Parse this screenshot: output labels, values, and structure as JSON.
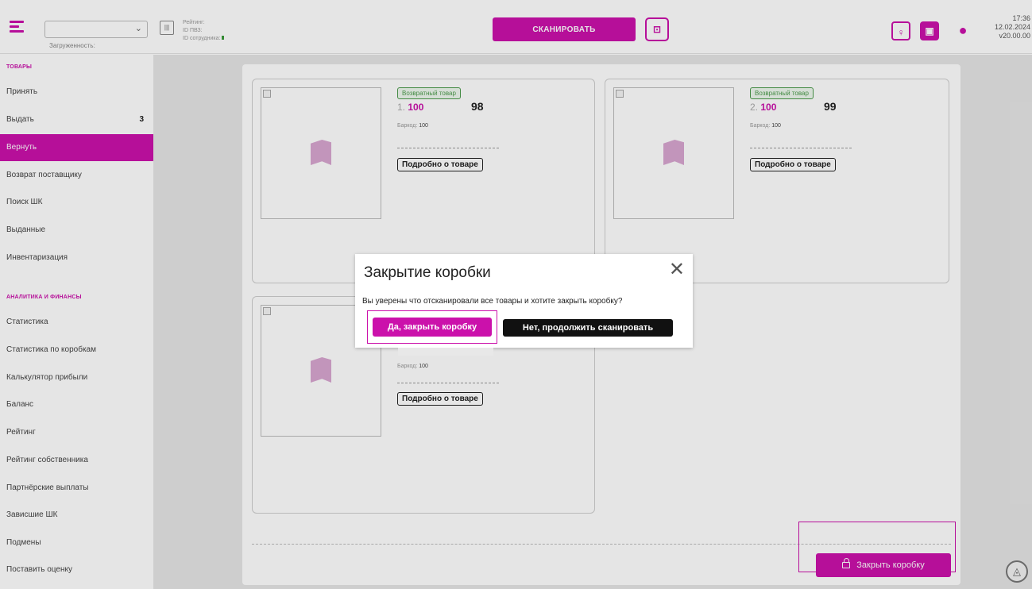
{
  "header": {
    "select_value": "",
    "load_label": "Загруженность:",
    "rating_label": "Рейтинг:",
    "pvz_label": "ID ПВЗ:",
    "employee_label": "ID сотрудника:",
    "scan_button": "СКАНИРОВАТЬ",
    "time": "17:36",
    "date": "12.02.2024",
    "version": "v20.00.00",
    "icons": [
      "burger-menu-icon",
      "barcode-icon",
      "qr-scan-icon",
      "badge-icon",
      "wallet-icon",
      "chat-icon"
    ]
  },
  "sidebar": {
    "section1": "ТОВАРЫ",
    "items1": [
      {
        "label": "Принять"
      },
      {
        "label": "Выдать",
        "count": "3"
      },
      {
        "label": "Вернуть",
        "active": true
      },
      {
        "label": "Возврат поставщику"
      },
      {
        "label": "Поиск ШК"
      },
      {
        "label": "Выданные"
      },
      {
        "label": "Инвентаризация"
      }
    ],
    "section2": "АНАЛИТИКА И ФИНАНСЫ",
    "items2": [
      {
        "label": "Статистика"
      },
      {
        "label": "Статистика по коробкам"
      },
      {
        "label": "Калькулятор прибыли"
      },
      {
        "label": "Баланс"
      },
      {
        "label": "Рейтинг"
      },
      {
        "label": "Рейтинг собственника"
      },
      {
        "label": "Партнёрские выплаты"
      },
      {
        "label": "Зависшие ШК"
      },
      {
        "label": "Подмены"
      },
      {
        "label": "Поставить оценку"
      }
    ]
  },
  "cards": [
    {
      "badge": "Возвратный товар",
      "num": "1.",
      "id": "100",
      "price": "98",
      "barcode_label": "Баркод:",
      "barcode": "100",
      "details": "Подробно о товаре"
    },
    {
      "badge": "Возвратный товар",
      "num": "2.",
      "id": "100",
      "price": "99",
      "barcode_label": "Баркод:",
      "barcode": "100",
      "details": "Подробно о товаре"
    },
    {
      "barcode_label": "Баркод:",
      "barcode": "100",
      "details": "Подробно о товаре"
    }
  ],
  "close_box_button": "Закрыть коробку",
  "modal": {
    "title": "Закрытие коробки",
    "text": "Вы уверены что отсканировали все товары и хотите закрыть коробку?",
    "yes": "Да, закрыть коробку",
    "no": "Нет, продолжить сканировать"
  },
  "colors": {
    "accent": "#cb11ab",
    "badge_green": "#4c9b4c"
  }
}
